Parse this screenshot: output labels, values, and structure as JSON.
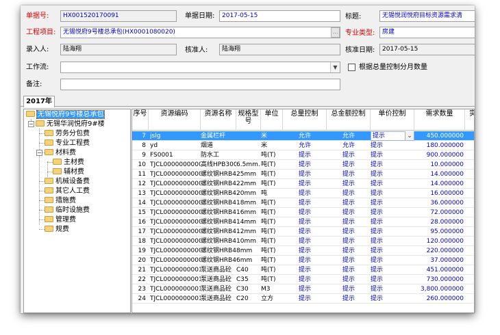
{
  "form": {
    "doc_no": {
      "label": "单据号:",
      "value": "HX001520170091"
    },
    "doc_date": {
      "label": "单据日期:",
      "value": "2017-05-15"
    },
    "title": {
      "label": "标题:",
      "value": "无锡悦润悦府目标资源需求清"
    },
    "project": {
      "label": "工程项目:",
      "value": "无锡悦府9号楼总承包(HX0001080020)"
    },
    "specialty": {
      "label": "专业类型:",
      "value": "房建"
    },
    "entered_by": {
      "label": "录入人:",
      "value": "陆海翔"
    },
    "approved_by": {
      "label": "核准人:",
      "value": "陆海翔"
    },
    "approve_date": {
      "label": "核准日期:",
      "value": "2017-05-15"
    },
    "workflow": {
      "label": "工作流:",
      "value": ""
    },
    "monthly_check": {
      "label": "根据总量控制分月数量"
    },
    "remarks": {
      "label": "备注:",
      "value": ""
    }
  },
  "tab": {
    "label": "2017年"
  },
  "tree": [
    {
      "label": "无锡悦府9号楼总承包",
      "selected": true
    },
    {
      "label": "无锡华润悦府9#楼"
    },
    {
      "label": "劳务分包费"
    },
    {
      "label": "专业工程费"
    },
    {
      "label": "材料费"
    },
    {
      "label": "主材费"
    },
    {
      "label": "辅材费"
    },
    {
      "label": "机械设备费"
    },
    {
      "label": "其它人工费"
    },
    {
      "label": "措施费"
    },
    {
      "label": "临时设施费"
    },
    {
      "label": "管理费"
    },
    {
      "label": "规费"
    }
  ],
  "grid": {
    "headers": [
      "序号",
      "资源编码",
      "资源名称",
      "规格型号",
      "单位",
      "总量控制",
      "总金额控制",
      "单价控制",
      "需求数量",
      "实"
    ],
    "rows": [
      [
        "7",
        "jslg",
        "金属栏杆",
        "",
        "米",
        "允许",
        "允许",
        "提示",
        "450.000000"
      ],
      [
        "8",
        "yd",
        "烟道",
        "",
        "米",
        "允许",
        "允许",
        "提示",
        "180.000000"
      ],
      [
        "9",
        "FS0001",
        "防水工",
        "",
        "吨(T)",
        "提示",
        "提示",
        "提示",
        "900.000000"
      ],
      [
        "10",
        "TJCL0000000000",
        "高线HPB300",
        "6.5mm.",
        "吨(T)",
        "提示",
        "提示",
        "提示",
        "10.000000"
      ],
      [
        "11",
        "TJCL0000000000",
        "螺纹钢HRB4",
        "25mm",
        "吨(T)",
        "提示",
        "提示",
        "提示",
        "14.000000"
      ],
      [
        "12",
        "TJCL0000000000",
        "螺纹钢HRB4",
        "22mm",
        "吨(T)",
        "提示",
        "提示",
        "提示",
        "14.000000"
      ],
      [
        "13",
        "TJCL0000000000",
        "螺纹钢HRB4",
        "20mm",
        "吨",
        "提示",
        "提示",
        "提示",
        "16.000000"
      ],
      [
        "14",
        "TJCL0000000000",
        "螺纹钢HRB4",
        "18mm",
        "吨(T)",
        "提示",
        "提示",
        "提示",
        "36.000000"
      ],
      [
        "15",
        "TJCL0000000000",
        "螺纹钢HRB4",
        "16mm",
        "吨(T)",
        "提示",
        "提示",
        "提示",
        "72.000000"
      ],
      [
        "16",
        "TJCL0000000000",
        "螺纹钢HRB4",
        "14mm",
        "吨(T)",
        "提示",
        "提示",
        "提示",
        "28.000000"
      ],
      [
        "17",
        "TJCL0000000000",
        "螺纹钢HRB4",
        "12mm",
        "吨(T)",
        "提示",
        "提示",
        "提示",
        "95.000000"
      ],
      [
        "18",
        "TJCL0000000000",
        "螺纹钢HRB4",
        "10mm",
        "吨(T)",
        "提示",
        "提示",
        "提示",
        "120.000000"
      ],
      [
        "19",
        "TJCL0000000000",
        "螺纹钢HRB4",
        "8mm",
        "吨(T)",
        "提示",
        "提示",
        "提示",
        "220.000000"
      ],
      [
        "20",
        "TJCL0000000000",
        "螺纹钢HRB4",
        "6mm",
        "吨(T)",
        "提示",
        "提示",
        "提示",
        "37.000000"
      ],
      [
        "21",
        "TJCL0000000001",
        "泵送商品砼",
        "C40",
        "吨(T)",
        "提示",
        "提示",
        "提示",
        "451.000000"
      ],
      [
        "22",
        "TJCL0000000001",
        "泵送商品砼",
        "C35",
        "吨(T)",
        "提示",
        "提示",
        "提示",
        "730.000000"
      ],
      [
        "23",
        "TJCL0000000001",
        "泵送商品砼",
        "C30",
        "M3",
        "提示",
        "提示",
        "提示",
        "3,800.000000"
      ],
      [
        "24",
        "TJCL0000000001",
        "泵送商品砼",
        "C20",
        "立方",
        "提示",
        "提示",
        "提示",
        "260.000000"
      ]
    ]
  }
}
